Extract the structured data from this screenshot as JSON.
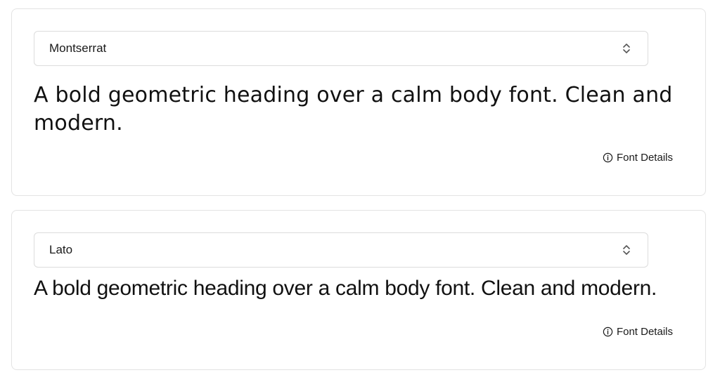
{
  "cards": [
    {
      "font_select_value": "Montserrat",
      "preview_text": "A bold geometric heading over a calm body font. Clean and modern.",
      "details_label": "Font Details"
    },
    {
      "font_select_value": "Lato",
      "preview_text": "A bold geometric heading over a calm body font. Clean and modern.",
      "details_label": "Font Details"
    }
  ],
  "icons": {
    "select_chevron": "chevron-up-down-icon",
    "details": "info-icon"
  },
  "colors": {
    "border": "#e3e3e3",
    "text": "#111111",
    "background": "#ffffff"
  }
}
